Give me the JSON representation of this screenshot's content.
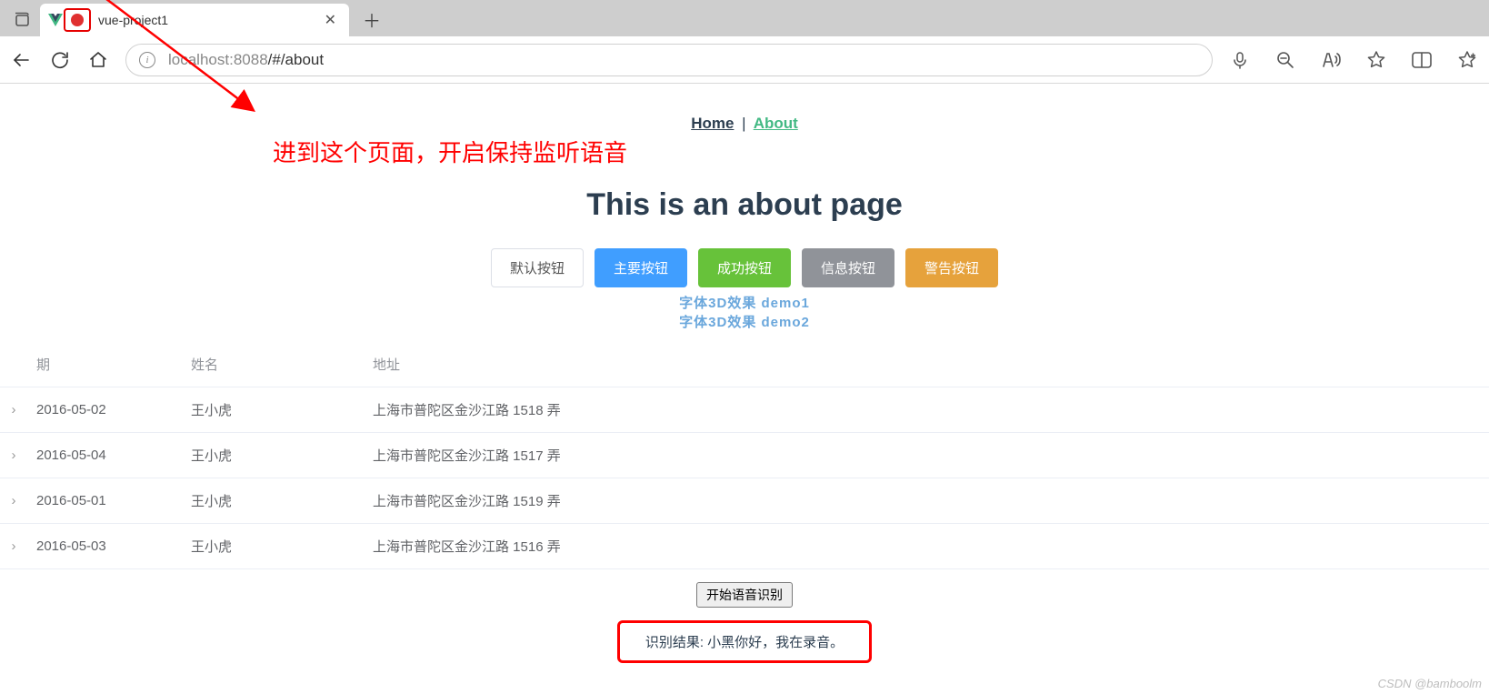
{
  "browser": {
    "tab_title": "vue-project1",
    "url_host": "localhost",
    "url_port": ":8088",
    "url_path": "/#/about"
  },
  "annotation": "进到这个页面，开启保持监听语音",
  "nav": {
    "home": "Home",
    "about": "About"
  },
  "page_title": "This is an about page",
  "buttons": {
    "default": "默认按钮",
    "primary": "主要按钮",
    "success": "成功按钮",
    "info": "信息按钮",
    "warning": "警告按钮"
  },
  "demo_text": {
    "line1": "字体3D效果 demo1",
    "line2": "字体3D效果 demo2"
  },
  "table": {
    "headers": {
      "date": "期",
      "name": "姓名",
      "address": "地址"
    },
    "rows": [
      {
        "date": "2016-05-02",
        "name": "王小虎",
        "address": "上海市普陀区金沙江路 1518 弄"
      },
      {
        "date": "2016-05-04",
        "name": "王小虎",
        "address": "上海市普陀区金沙江路 1517 弄"
      },
      {
        "date": "2016-05-01",
        "name": "王小虎",
        "address": "上海市普陀区金沙江路 1519 弄"
      },
      {
        "date": "2016-05-03",
        "name": "王小虎",
        "address": "上海市普陀区金沙江路 1516 弄"
      }
    ]
  },
  "speech": {
    "button": "开始语音识别",
    "result_label": "识别结果: ",
    "result_text": "小黑你好，我在录音。"
  },
  "watermark": "CSDN @bamboolm"
}
